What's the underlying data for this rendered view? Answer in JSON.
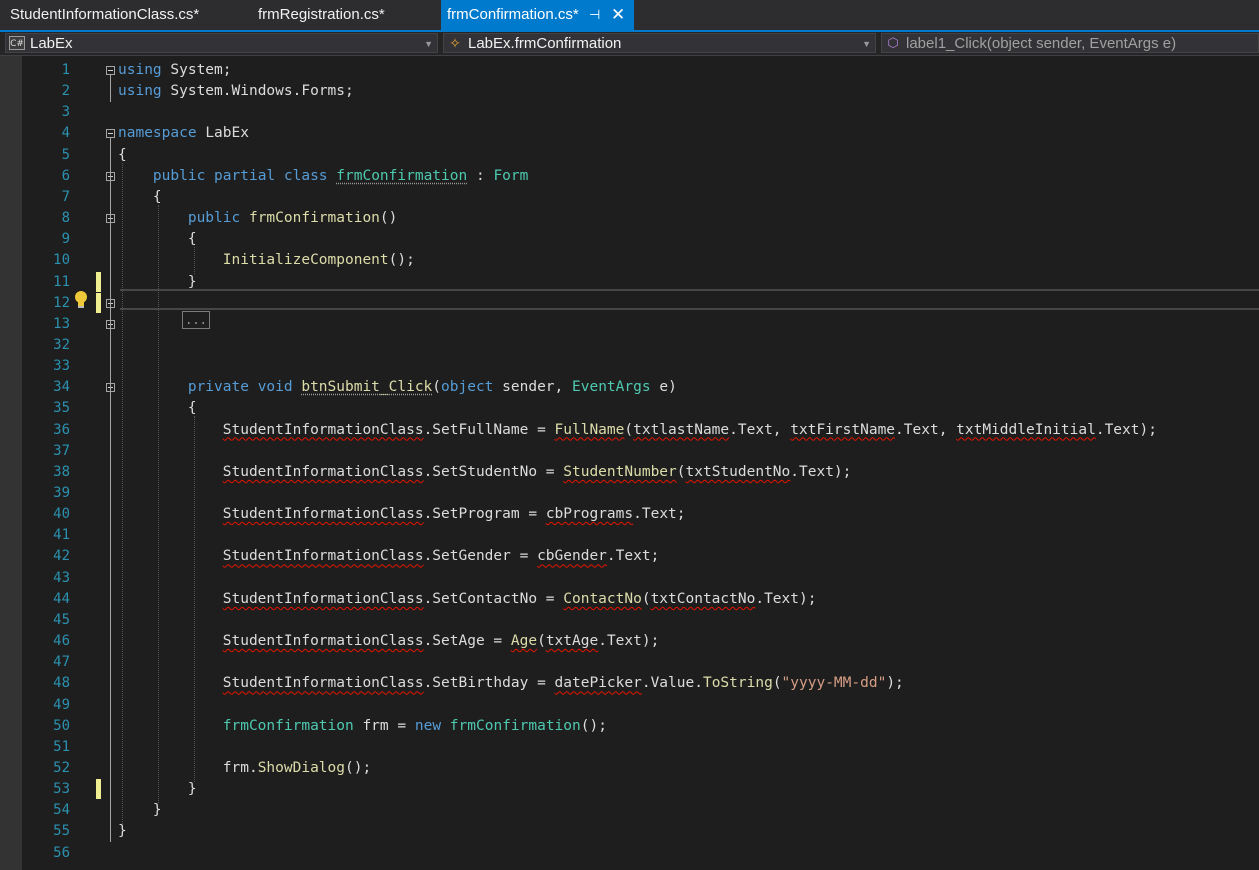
{
  "tabs": [
    {
      "label": "StudentInformationClass.cs*"
    },
    {
      "label": "frmRegistration.cs*"
    },
    {
      "label": "frmConfirmation.cs*",
      "active": true
    }
  ],
  "nav": {
    "project": "LabEx",
    "class": "LabEx.frmConfirmation",
    "member": "label1_Click(object sender, EventArgs e)"
  },
  "collapsed_label": "...",
  "lines": [
    {
      "n": "1",
      "t": "using System;"
    },
    {
      "n": "2",
      "t": "using System.Windows.Forms;"
    },
    {
      "n": "3",
      "t": ""
    },
    {
      "n": "4",
      "t": "namespace LabEx"
    },
    {
      "n": "5",
      "t": "{"
    },
    {
      "n": "6",
      "t": "    public partial class frmConfirmation : Form"
    },
    {
      "n": "7",
      "t": "    {"
    },
    {
      "n": "8",
      "t": "        public frmConfirmation()"
    },
    {
      "n": "9",
      "t": "        {"
    },
    {
      "n": "10",
      "t": "            InitializeComponent();"
    },
    {
      "n": "11",
      "t": "        }"
    },
    {
      "n": "12",
      "t": ""
    },
    {
      "n": "13",
      "t": ""
    },
    {
      "n": "32",
      "t": ""
    },
    {
      "n": "33",
      "t": ""
    },
    {
      "n": "34",
      "t": "        private void btnSubmit_Click(object sender, EventArgs e)"
    },
    {
      "n": "35",
      "t": "        {"
    },
    {
      "n": "36",
      "t": "            StudentInformationClass.SetFullName = FullName(txtlastName.Text, txtFirstName.Text, txtMiddleInitial.Text);"
    },
    {
      "n": "37",
      "t": ""
    },
    {
      "n": "38",
      "t": "            StudentInformationClass.SetStudentNo = StudentNumber(txtStudentNo.Text);"
    },
    {
      "n": "39",
      "t": ""
    },
    {
      "n": "40",
      "t": "            StudentInformationClass.SetProgram = cbPrograms.Text;"
    },
    {
      "n": "41",
      "t": ""
    },
    {
      "n": "42",
      "t": "            StudentInformationClass.SetGender = cbGender.Text;"
    },
    {
      "n": "43",
      "t": ""
    },
    {
      "n": "44",
      "t": "            StudentInformationClass.SetContactNo = ContactNo(txtContactNo.Text);"
    },
    {
      "n": "45",
      "t": ""
    },
    {
      "n": "46",
      "t": "            StudentInformationClass.SetAge = Age(txtAge.Text);"
    },
    {
      "n": "47",
      "t": ""
    },
    {
      "n": "48",
      "t": "            StudentInformationClass.SetBirthday = datePicker.Value.ToString(\"yyyy-MM-dd\");"
    },
    {
      "n": "49",
      "t": ""
    },
    {
      "n": "50",
      "t": "            frmConfirmation frm = new frmConfirmation();"
    },
    {
      "n": "51",
      "t": ""
    },
    {
      "n": "52",
      "t": "            frm.ShowDialog();"
    },
    {
      "n": "53",
      "t": "        }"
    },
    {
      "n": "54",
      "t": "    }"
    },
    {
      "n": "55",
      "t": "}"
    },
    {
      "n": "56",
      "t": ""
    }
  ]
}
